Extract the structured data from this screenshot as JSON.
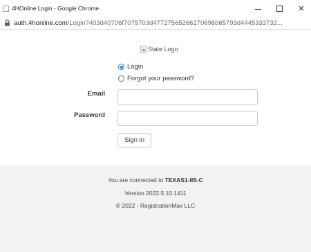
{
  "window": {
    "title": "4HOnline Login - Google Chrome",
    "minimize_icon": "minimize-icon",
    "maximize_icon": "maximize-icon",
    "close_symbol": "✕"
  },
  "address_bar": {
    "host": "auth.4honline.com",
    "path": "/Login?403d40706f7075703d47727565266170696b65793d4445333732..."
  },
  "logo": {
    "alt_text": "State Logo"
  },
  "mode": {
    "options": [
      {
        "label": "Login",
        "selected": true
      },
      {
        "label": "Forgot your password?",
        "selected": false
      }
    ]
  },
  "form": {
    "email_label": "Email",
    "email_value": "",
    "password_label": "Password",
    "password_value": "",
    "submit_label": "Sign in"
  },
  "footer": {
    "connected_prefix": "You are connected to",
    "server": "TEXAS1-IIS-C",
    "version": "Version 2022.5.10.1411",
    "copyright": "© 2022 - RegistrationMax LLC"
  },
  "colors": {
    "accent": "#1a73e8",
    "footer_bg": "#f2f2f2"
  }
}
